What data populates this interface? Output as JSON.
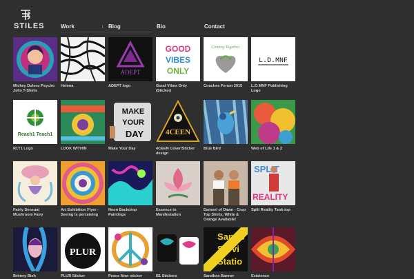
{
  "brand": {
    "logo_text": "STILES"
  },
  "nav": [
    {
      "label": "Work",
      "has_dropdown": true
    },
    {
      "label": "Blog"
    },
    {
      "label": "Bio"
    },
    {
      "label": "Contact"
    }
  ],
  "portfolio": [
    {
      "title": "Mickey Dolenz Psycho Jello T-Shirts"
    },
    {
      "title": "Helena"
    },
    {
      "title": "ADEPT logo"
    },
    {
      "title": "Good Vibes Only (Sticker)"
    },
    {
      "title": "Coaches Forum 2015"
    },
    {
      "title": "L.D.MNF Publishing Logo"
    },
    {
      "title": "R1T1 Logo"
    },
    {
      "title": "LOOK WITHIN"
    },
    {
      "title": "Make Your Day"
    },
    {
      "title": "4CEEN Cover/Sticker design"
    },
    {
      "title": "Blue Bird"
    },
    {
      "title": "Web of Life 1 & 2"
    },
    {
      "title": "Fairly Sensual Mushroom Fairy"
    },
    {
      "title": "Art Exhibition Flyer - Seeing Is perceiving"
    },
    {
      "title": "Neon Backdrop Paintings"
    },
    {
      "title": "Essence to Manifestation"
    },
    {
      "title": "Damsel of Dawn - Crop Top Shirts, White & Orange Available!"
    },
    {
      "title": "Split Reality Tank-top"
    },
    {
      "title": "Britney Bish"
    },
    {
      "title": "PLUR Sticker"
    },
    {
      "title": "Peace Now sticker"
    },
    {
      "title": "B1 Stickers"
    },
    {
      "title": "Sandbox Banner"
    },
    {
      "title": "Existence"
    }
  ],
  "artwork_text": {
    "adept": "ADEPT",
    "good_vibes": [
      "GOOD",
      "VIBES",
      "ONLY"
    ],
    "coaches": "Coming Together",
    "ldmnf": "L.D.MNF",
    "reach1": "Reach1 Teach1",
    "make_your_day": [
      "MAKE",
      "YOUR",
      "DAY"
    ],
    "foureen": "4CEEN",
    "split_reality": [
      "SPLIT",
      "REALITY"
    ],
    "plur": "PLUR",
    "sandbox": [
      "Sandb",
      "Servi",
      "Statio"
    ]
  }
}
